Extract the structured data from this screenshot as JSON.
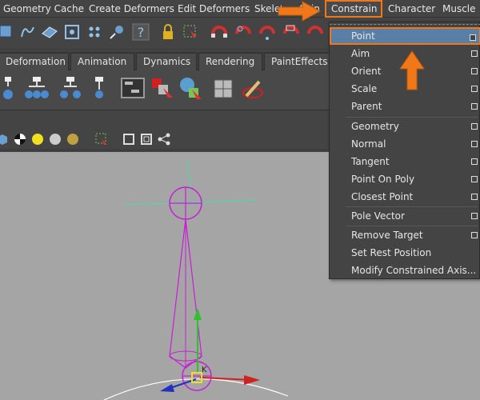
{
  "menubar": {
    "items": [
      "Geometry Cache",
      "Create Deformers",
      "Edit Deformers",
      "Skeleton",
      "Skin",
      "Constrain",
      "Character",
      "Muscle"
    ]
  },
  "shelf_tabs": [
    "Deformation",
    "Animation",
    "Dynamics",
    "Rendering",
    "PaintEffects"
  ],
  "constrain_menu": {
    "items": [
      {
        "label": "Point",
        "option_box": true
      },
      {
        "label": "Aim",
        "option_box": true
      },
      {
        "label": "Orient",
        "option_box": true
      },
      {
        "label": "Scale",
        "option_box": true
      },
      {
        "label": "Parent",
        "option_box": true
      },
      {
        "label": "Geometry",
        "option_box": true
      },
      {
        "label": "Normal",
        "option_box": true
      },
      {
        "label": "Tangent",
        "option_box": true
      },
      {
        "label": "Point On Poly",
        "option_box": true
      },
      {
        "label": "Closest Point",
        "option_box": true
      },
      {
        "label": "Pole Vector",
        "option_box": true
      },
      {
        "label": "Remove Target",
        "option_box": true
      },
      {
        "label": "Set Rest Position",
        "option_box": false
      },
      {
        "label": "Modify Constrained Axis...",
        "option_box": false
      }
    ],
    "selected": "Point"
  },
  "colors": {
    "highlight_orange": "#f07818",
    "selection_blue": "#5a7fa6",
    "joint_magenta": "#c61ed6",
    "viewport_gray": "#a5a5a5"
  }
}
